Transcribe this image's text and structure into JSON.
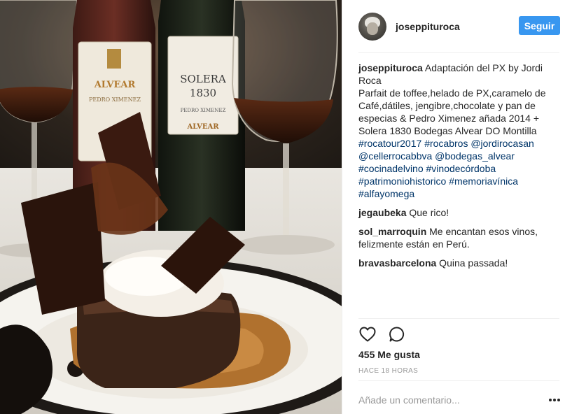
{
  "post": {
    "photo_alt": "Foto de josepppituroca",
    "bottle_left": {
      "brand": "ALVEAR",
      "subtitle": "PEDRO XIMENEZ"
    },
    "bottle_right": {
      "name_line1": "SOLERA",
      "name_line2": "1830",
      "subtitle": "PEDRO XIMENEZ",
      "brand": "ALVEAR"
    }
  },
  "header": {
    "username": "joseppituroca",
    "follow_label": "Seguir"
  },
  "comments": [
    {
      "user": "joseppituroca",
      "parts": [
        {
          "text": " Adaptación del PX by Jordi Roca",
          "tag": false
        },
        {
          "text": "\nParfait de toffee,helado de PX,caramelo de Café,dátiles, jengibre,chocolate y pan de especias & Pedro Ximenez añada 2014 + Solera 1830 Bodegas Alvear DO Montilla ",
          "tag": false
        },
        {
          "text": "#rocatour2017",
          "tag": true
        },
        {
          "text": " ",
          "tag": false
        },
        {
          "text": "#rocabros",
          "tag": true
        },
        {
          "text": " ",
          "tag": false
        },
        {
          "text": "@jordirocasan",
          "tag": true
        },
        {
          "text": " ",
          "tag": false
        },
        {
          "text": "@cellerrocabbva",
          "tag": true
        },
        {
          "text": " ",
          "tag": false
        },
        {
          "text": "@bodegas_alvear",
          "tag": true
        },
        {
          "text": " ",
          "tag": false
        },
        {
          "text": "#cocinadelvino",
          "tag": true
        },
        {
          "text": " ",
          "tag": false
        },
        {
          "text": "#vinodecórdoba",
          "tag": true
        },
        {
          "text": " ",
          "tag": false
        },
        {
          "text": "#patrimoniohistorico",
          "tag": true
        },
        {
          "text": " ",
          "tag": false
        },
        {
          "text": "#memoriavínica",
          "tag": true
        },
        {
          "text": " ",
          "tag": false
        },
        {
          "text": "#alfayomega",
          "tag": true
        }
      ]
    },
    {
      "user": "jegaubeka",
      "parts": [
        {
          "text": " Que rico!",
          "tag": false
        }
      ]
    },
    {
      "user": "sol_marroquin",
      "parts": [
        {
          "text": " Me encantan esos vinos, felizmente están en Perú.",
          "tag": false
        }
      ]
    },
    {
      "user": "bravasbarcelona",
      "parts": [
        {
          "text": " Quina passada!",
          "tag": false
        }
      ]
    }
  ],
  "actions": {
    "like_icon": "heart-icon",
    "comment_icon": "comment-icon",
    "likes_text": "455 Me gusta",
    "time_text": "HACE 18 HORAS"
  },
  "composer": {
    "placeholder": "Añade un comentario...",
    "more_icon": "more-options-icon"
  },
  "colors": {
    "follow_button": "#3897f0",
    "tag_link": "#003569",
    "muted": "#999999",
    "divider": "#efefef"
  }
}
